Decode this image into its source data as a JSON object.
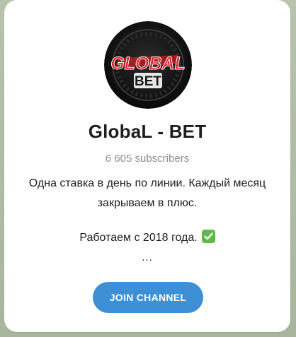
{
  "channel": {
    "title": "GlobaL - BET",
    "subscribers": "6 605 subscribers",
    "description_lines": [
      "Одна ставка в день по линии. Каждый месяц",
      "закрываем в плюс."
    ],
    "since": "Работаем с 2018 года.",
    "since_icon": "check-mark-button-icon",
    "more": "...",
    "avatar": {
      "logo_top": "GLOBAL",
      "logo_bottom": "BET",
      "accent": "#c8242b"
    }
  },
  "actions": {
    "join_label": "JOIN CHANNEL",
    "join_color": "#3d8fd6"
  },
  "colors": {
    "background": "#a9b8a0",
    "card": "#ffffff",
    "subtitle": "#8a8f96",
    "check": "#5fb94a"
  }
}
